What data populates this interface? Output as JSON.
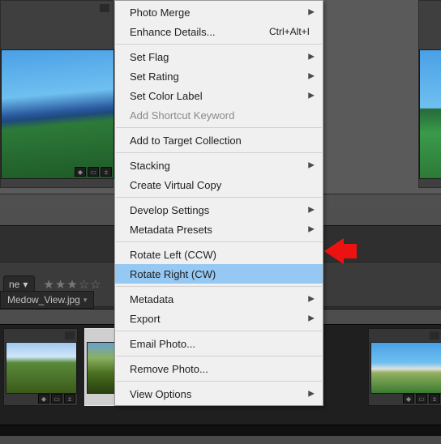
{
  "sort": {
    "suffix_label": "ne"
  },
  "rating": {
    "stars_glyphs": "★★★☆☆"
  },
  "filename": {
    "current": "Medow_View.jpg"
  },
  "menu": {
    "items": [
      {
        "label": "Photo Merge",
        "submenu": true
      },
      {
        "label": "Enhance Details...",
        "accel": "Ctrl+Alt+I"
      },
      {
        "sep": true
      },
      {
        "label": "Set Flag",
        "submenu": true
      },
      {
        "label": "Set Rating",
        "submenu": true
      },
      {
        "label": "Set Color Label",
        "submenu": true
      },
      {
        "label": "Add Shortcut Keyword",
        "disabled": true
      },
      {
        "sep": true
      },
      {
        "label": "Add to Target Collection"
      },
      {
        "sep": true
      },
      {
        "label": "Stacking",
        "submenu": true
      },
      {
        "label": "Create Virtual Copy"
      },
      {
        "sep": true
      },
      {
        "label": "Develop Settings",
        "submenu": true
      },
      {
        "label": "Metadata Presets",
        "submenu": true
      },
      {
        "sep": true
      },
      {
        "label": "Rotate Left (CCW)"
      },
      {
        "label": "Rotate Right (CW)",
        "highlight": true
      },
      {
        "sep": true
      },
      {
        "label": "Metadata",
        "submenu": true
      },
      {
        "label": "Export",
        "submenu": true
      },
      {
        "sep": true
      },
      {
        "label": "Email Photo..."
      },
      {
        "sep": true
      },
      {
        "label": "Remove Photo..."
      },
      {
        "sep": true
      },
      {
        "label": "View Options",
        "submenu": true
      }
    ]
  },
  "icons": {
    "submenu_glyph": "▶",
    "dropdown_glyph": "▾"
  }
}
